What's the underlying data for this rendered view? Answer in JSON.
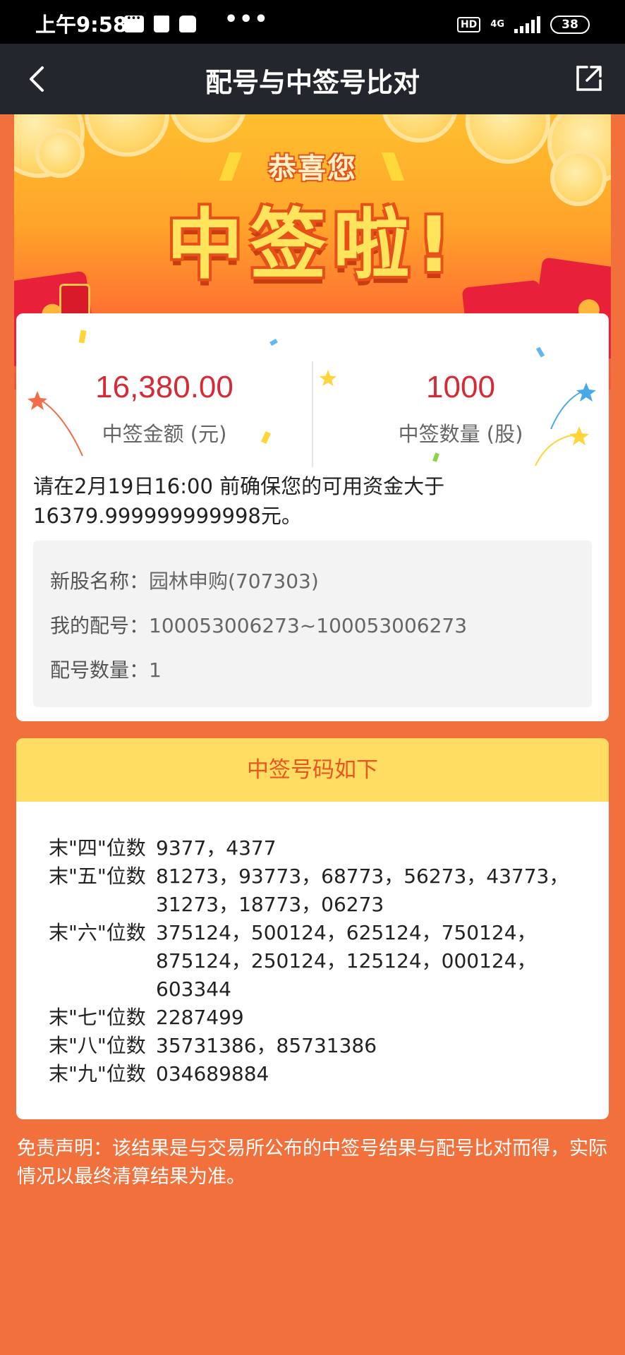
{
  "status_bar": {
    "time": "上午9:58",
    "more": "•••",
    "hd": "HD",
    "network": "4G",
    "battery": "38"
  },
  "nav": {
    "title": "配号与中签号比对",
    "back_icon": "chevron-left-icon",
    "share_icon": "external-share-icon"
  },
  "banner": {
    "subtitle": "恭喜您",
    "headline": "中签啦!",
    "firecracker_char": "签"
  },
  "result": {
    "amount": {
      "value": "16,380.00",
      "label": "中签金额 (元)"
    },
    "quantity": {
      "value": "1000",
      "label": "中签数量 (股)"
    },
    "notice": "请在2月19日16:00 前确保您的可用资金大于16379.999999999998元。",
    "details": [
      {
        "key": "新股名称：",
        "value": "园林申购(707303)"
      },
      {
        "key": "我的配号：",
        "value": "100053006273~100053006273"
      },
      {
        "key": "配号数量：",
        "value": "1"
      }
    ]
  },
  "lottery": {
    "header": "中签号码如下",
    "rows": [
      {
        "label": "末\"四\"位数",
        "lines": [
          "9377，4377"
        ]
      },
      {
        "label": "末\"五\"位数",
        "lines": [
          "81273，93773，68773，56273，43773，",
          "31273，18773，06273"
        ]
      },
      {
        "label": "末\"六\"位数",
        "lines": [
          "375124，500124，625124，750124，",
          "875124，250124，125124，000124，",
          "603344"
        ]
      },
      {
        "label": "末\"七\"位数",
        "lines": [
          "2287499"
        ]
      },
      {
        "label": "末\"八\"位数",
        "lines": [
          "35731386，85731386"
        ]
      },
      {
        "label": "末\"九\"位数",
        "lines": [
          "034689884"
        ]
      }
    ]
  },
  "disclaimer": "免责声明：该结果是与交易所公布的中签号结果与配号比对而得，实际情况以最终清算结果为准。",
  "colors": {
    "page_bg": "#f2703b",
    "nav_bg": "#23262d",
    "accent_red": "#d62b36",
    "header_yellow": "#ffdd63",
    "header_text": "#e8571f"
  }
}
